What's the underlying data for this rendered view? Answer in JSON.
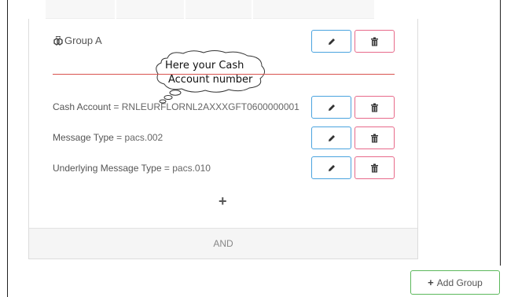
{
  "group": {
    "icon": "cubes-icon",
    "title": "Group A"
  },
  "callout": {
    "line1": "Here your Cash",
    "line2": "Account number"
  },
  "conditions": [
    {
      "key": "Cash Account",
      "op": " = ",
      "value": "RNLEURFLORNL2AXXXGFT0600000001"
    },
    {
      "key": "Message Type",
      "op": " = ",
      "value": "pacs.002"
    },
    {
      "key": "Underlying Message Type",
      "op": " = ",
      "value": "pacs.010"
    }
  ],
  "add_condition_symbol": "+",
  "operator_label": "AND",
  "add_group": {
    "symbol": "+",
    "label": "Add Group"
  },
  "colors": {
    "edit_border": "#4aa3df",
    "delete_border": "#e76a8a",
    "divider": "#d9534f",
    "add_group_border": "#5cb85c"
  }
}
